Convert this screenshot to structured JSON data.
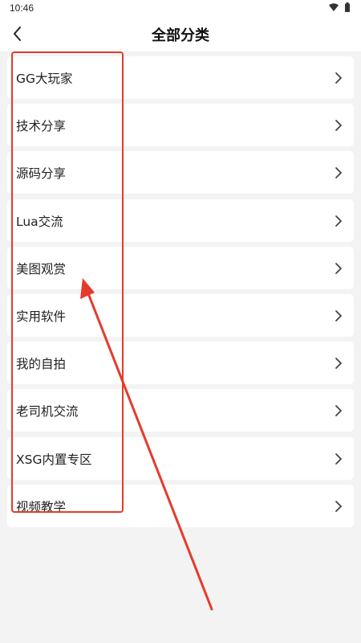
{
  "status_bar": {
    "time": "10:46"
  },
  "header": {
    "title": "全部分类",
    "back_icon": "chevron-left-icon"
  },
  "categories": [
    {
      "label": "GG大玩家"
    },
    {
      "label": "技术分享"
    },
    {
      "label": "源码分享"
    },
    {
      "label": "Lua交流"
    },
    {
      "label": "美图观赏"
    },
    {
      "label": "实用软件"
    },
    {
      "label": "我的自拍"
    },
    {
      "label": "老司机交流"
    },
    {
      "label": "XSG内置专区"
    },
    {
      "label": "视频教学"
    }
  ],
  "colors": {
    "annotation": "#e53a2b",
    "background": "#f3f3f3",
    "card": "#ffffff",
    "text": "#222222",
    "chevron": "#444444"
  }
}
